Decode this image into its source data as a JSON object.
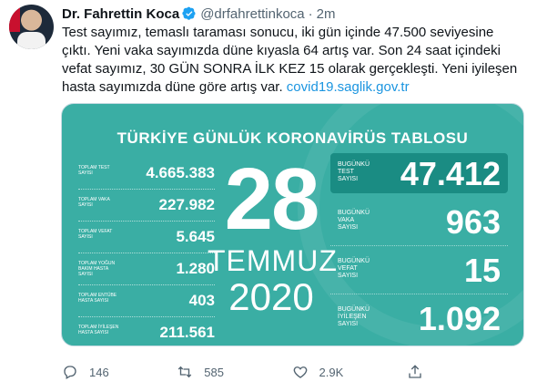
{
  "author": {
    "name": "Dr. Fahrettin Koca",
    "handle": "@drfahrettinkoca",
    "separator": "·",
    "time": "2m"
  },
  "tweet": {
    "text": "Test sayımız, temaslı taraması sonucu, iki gün içinde 47.500 seviyesine çıktı. Yeni vaka sayımızda düne kıyasla 64 artış var. Son 24 saat içindeki vefat sayımız, 30 GÜN SONRA İLK KEZ 15 olarak gerçekleşti. Yeni iyileşen hasta sayımızda düne göre artış var. ",
    "link": "covid19.saglik.gov.tr"
  },
  "card": {
    "title": "TÜRKİYE GÜNLÜK KORONAVİRÜS TABLOSU",
    "totals": [
      {
        "label": "TOPLAM TEST SAYISI",
        "value": "4.665.383"
      },
      {
        "label": "TOPLAM VAKA SAYISI",
        "value": "227.982"
      },
      {
        "label": "TOPLAM VEFAT SAYISI",
        "value": "5.645"
      },
      {
        "label": "TOPLAM YOĞUN BAKIM HASTA SAYISI",
        "value": "1.280"
      },
      {
        "label": "TOPLAM ENTÜBE HASTA SAYISI",
        "value": "403"
      },
      {
        "label": "TOPLAM İYİLEŞEN HASTA SAYISI",
        "value": "211.561"
      }
    ],
    "date": {
      "day": "28",
      "month": "TEMMUZ",
      "year": "2020"
    },
    "daily": [
      {
        "label": "BUGÜNKÜ TEST SAYISI",
        "value": "47.412"
      },
      {
        "label": "BUGÜNKÜ VAKA SAYISI",
        "value": "963"
      },
      {
        "label": "BUGÜNKÜ VEFAT SAYISI",
        "value": "15"
      },
      {
        "label": "BUGÜNKÜ İYİLEŞEN SAYISI",
        "value": "1.092"
      }
    ]
  },
  "actions": {
    "reply_count": "146",
    "retweet_count": "585",
    "like_count": "2.9K"
  },
  "icons": {
    "verified": "verified-badge-icon",
    "reply": "reply-icon",
    "retweet": "retweet-icon",
    "like": "like-icon",
    "share": "share-icon"
  },
  "colors": {
    "card_bg": "#3aaea4",
    "card_box": "#1a8c83",
    "link": "#1b95e0",
    "verified": "#1da1f2"
  }
}
